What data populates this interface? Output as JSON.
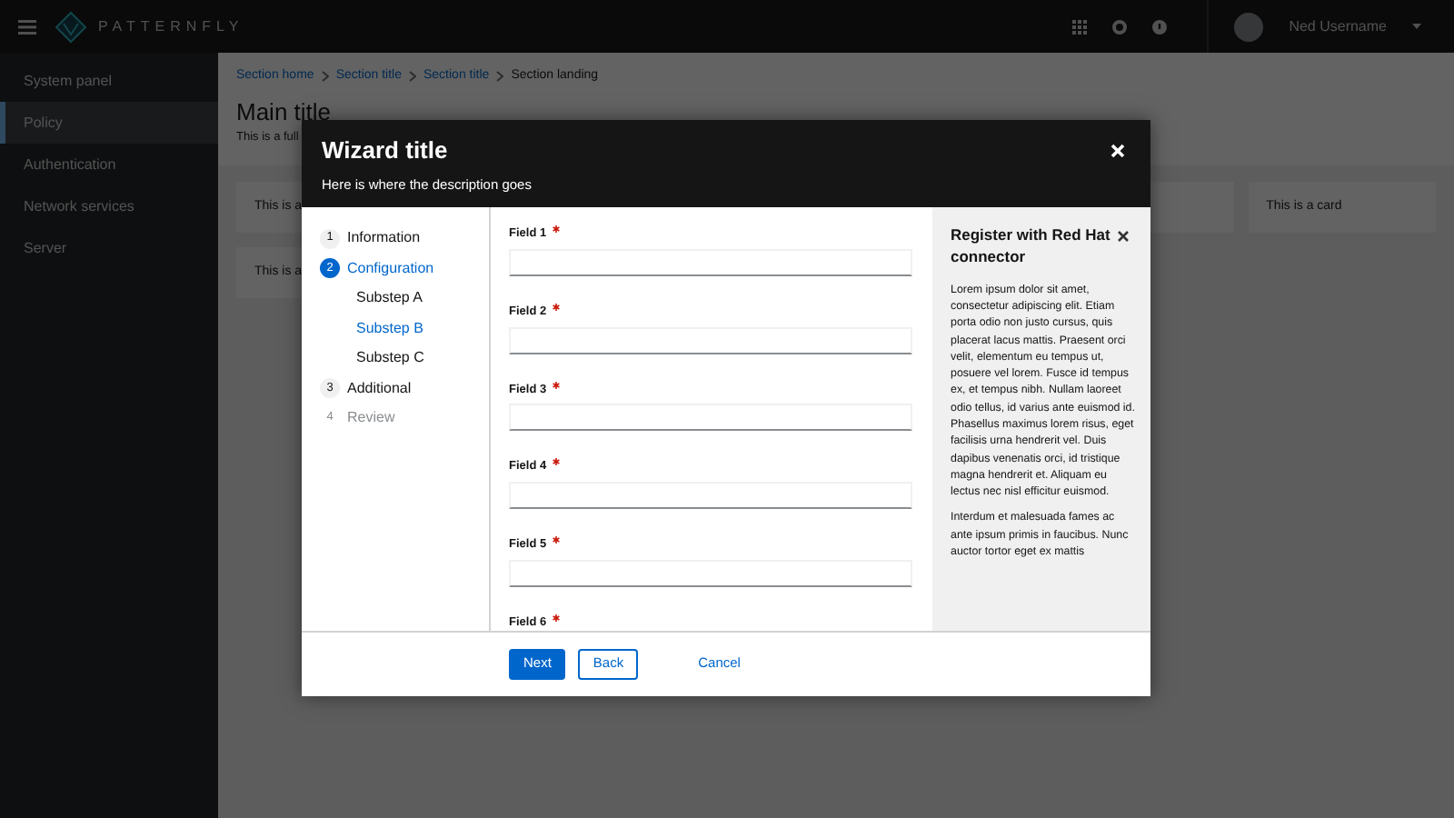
{
  "masthead": {
    "brand": "PATTERNFLY",
    "user": "Ned Username"
  },
  "sidebar": {
    "items": [
      {
        "label": "System panel",
        "selected": false
      },
      {
        "label": "Policy",
        "selected": true
      },
      {
        "label": "Authentication",
        "selected": false
      },
      {
        "label": "Network services",
        "selected": false
      },
      {
        "label": "Server",
        "selected": false
      }
    ]
  },
  "breadcrumb": [
    {
      "label": "Section home",
      "link": true
    },
    {
      "label": "Section title",
      "link": true
    },
    {
      "label": "Section title",
      "link": true
    },
    {
      "label": "Section landing",
      "link": false
    }
  ],
  "page": {
    "title": "Main title",
    "description": "This is a full"
  },
  "card_rows": [
    [
      {
        "text": "This is a"
      },
      {
        "text": "This is a card"
      }
    ],
    [
      {
        "text": "This is a"
      }
    ]
  ],
  "wizard": {
    "title": "Wizard title",
    "description": "Here is where the description goes",
    "steps": [
      {
        "number": "1",
        "label": "Information",
        "selected": false,
        "disabled": false
      },
      {
        "number": "2",
        "label": "Configuration",
        "selected": true,
        "disabled": false,
        "substeps": [
          {
            "label": "Substep A",
            "selected": false
          },
          {
            "label": "Substep B",
            "selected": true
          },
          {
            "label": "Substep C",
            "selected": false
          }
        ]
      },
      {
        "number": "3",
        "label": "Additional",
        "selected": false,
        "disabled": false
      },
      {
        "number": "4",
        "label": "Review",
        "selected": false,
        "disabled": true
      }
    ],
    "fields": [
      {
        "label": "Field 1",
        "required": true
      },
      {
        "label": "Field 2",
        "required": true
      },
      {
        "label": "Field 3",
        "required": true
      },
      {
        "label": "Field 4",
        "required": true
      },
      {
        "label": "Field 5",
        "required": true
      },
      {
        "label": "Field 6",
        "required": true
      }
    ],
    "drawer": {
      "title": "Register with Red Hat connector",
      "paragraphs": [
        "Lorem ipsum dolor sit amet, consectetur adipiscing elit. Etiam porta odio non justo cursus, quis placerat lacus mattis. Praesent orci velit, elementum eu tempus ut, posuere vel lorem. Fusce id tempus ex, et tempus nibh. Nullam laoreet odio tellus, id varius ante euismod id. Phasellus maximus lorem risus, eget facilisis urna hendrerit vel. Duis dapibus venenatis orci, id tristique magna hendrerit et. Aliquam eu lectus nec nisl efficitur euismod.",
        "Interdum et malesuada fames ac ante ipsum primis in faucibus. Nunc auctor tortor eget ex mattis"
      ]
    },
    "buttons": [
      {
        "label": "Next",
        "kind": "primary"
      },
      {
        "label": "Back",
        "kind": "secondary"
      },
      {
        "label": "Cancel",
        "kind": "link"
      }
    ]
  }
}
